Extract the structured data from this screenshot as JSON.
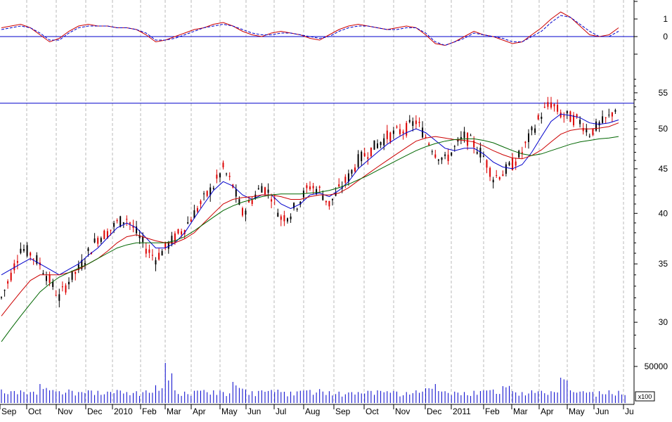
{
  "chart_data": [
    {
      "type": "line",
      "panel": "oscillator",
      "title": "",
      "y_ticks": [
        "1",
        "0"
      ],
      "reference_line": 0,
      "series": [
        {
          "color": "#cc0000",
          "style": "solid",
          "values": [
            0.5,
            0.6,
            0.7,
            0.5,
            0.1,
            -0.3,
            -0.1,
            0.3,
            0.6,
            0.7,
            0.6,
            0.6,
            0.5,
            0.5,
            0.4,
            0.1,
            -0.3,
            -0.2,
            0.0,
            0.2,
            0.4,
            0.5,
            0.7,
            0.8,
            0.6,
            0.3,
            0.1,
            0.0,
            0.2,
            0.3,
            0.2,
            0.1,
            -0.1,
            -0.2,
            0.1,
            0.4,
            0.6,
            0.7,
            0.6,
            0.5,
            0.4,
            0.5,
            0.6,
            0.5,
            0.1,
            -0.4,
            -0.5,
            -0.3,
            0.0,
            0.3,
            0.1,
            0.0,
            -0.2,
            -0.4,
            -0.3,
            0.1,
            0.5,
            1.0,
            1.4,
            1.1,
            0.6,
            0.1,
            0.0,
            0.1,
            0.5
          ]
        },
        {
          "color": "#0000cc",
          "style": "dashed",
          "values": [
            0.4,
            0.5,
            0.6,
            0.5,
            0.2,
            -0.2,
            -0.2,
            0.2,
            0.5,
            0.6,
            0.6,
            0.6,
            0.5,
            0.5,
            0.4,
            0.2,
            -0.2,
            -0.2,
            -0.1,
            0.1,
            0.3,
            0.5,
            0.6,
            0.7,
            0.6,
            0.4,
            0.2,
            0.1,
            0.1,
            0.2,
            0.2,
            0.1,
            0.0,
            -0.1,
            0.0,
            0.3,
            0.5,
            0.6,
            0.6,
            0.5,
            0.4,
            0.4,
            0.5,
            0.5,
            0.2,
            -0.3,
            -0.5,
            -0.3,
            -0.1,
            0.2,
            0.1,
            0.0,
            -0.1,
            -0.3,
            -0.3,
            0.0,
            0.3,
            0.8,
            1.2,
            1.1,
            0.7,
            0.3,
            0.0,
            0.0,
            0.3
          ]
        }
      ]
    },
    {
      "type": "line",
      "panel": "price",
      "title": "",
      "y_axis": {
        "scale": "log",
        "range": [
          27.5,
          57.5
        ],
        "ticks": [
          55,
          50,
          45,
          40,
          35,
          30
        ]
      },
      "reference_line": 53.5,
      "series": [
        {
          "name": "",
          "color": "#000000",
          "style": "price",
          "values": [
            32.0,
            34.0,
            36.5,
            36.0,
            35.0,
            33.5,
            32.0,
            33.5,
            34.5,
            36.0,
            37.5,
            38.0,
            39.0,
            39.5,
            38.0,
            36.5,
            35.5,
            36.5,
            37.5,
            38.5,
            40.0,
            41.5,
            43.0,
            45.0,
            43.0,
            40.0,
            41.5,
            43.0,
            42.0,
            39.5,
            40.0,
            41.5,
            43.0,
            42.5,
            41.0,
            42.5,
            44.0,
            46.0,
            47.0,
            48.0,
            49.0,
            49.5,
            50.0,
            51.0,
            49.0,
            47.0,
            46.0,
            47.5,
            49.0,
            48.0,
            46.5,
            44.0,
            44.5,
            45.5,
            47.0,
            49.5,
            52.0,
            53.5,
            52.0,
            51.5,
            51.0,
            49.5,
            50.5,
            51.5,
            53.5
          ]
        },
        {
          "name": "",
          "color": "#0000cc",
          "style": "solid",
          "values": [
            34.0,
            34.5,
            35.0,
            35.5,
            35.0,
            34.5,
            34.0,
            34.5,
            35.0,
            35.8,
            36.5,
            37.5,
            38.5,
            39.0,
            38.5,
            37.5,
            36.5,
            36.5,
            37.0,
            38.0,
            39.5,
            41.0,
            42.5,
            43.5,
            43.0,
            42.0,
            41.5,
            42.0,
            42.0,
            41.0,
            40.5,
            41.0,
            42.0,
            42.2,
            41.8,
            42.5,
            43.5,
            45.0,
            46.0,
            47.0,
            48.0,
            48.8,
            49.5,
            50.0,
            49.5,
            48.5,
            47.5,
            47.2,
            47.5,
            47.5,
            46.8,
            45.8,
            45.2,
            45.0,
            45.5,
            47.0,
            49.0,
            51.0,
            52.0,
            51.8,
            51.5,
            50.8,
            50.6,
            50.8,
            51.2
          ]
        },
        {
          "name": "",
          "color": "#cc0000",
          "style": "solid",
          "values": [
            30.5,
            31.5,
            32.5,
            33.5,
            34.0,
            34.0,
            34.0,
            34.2,
            34.5,
            35.0,
            35.5,
            36.2,
            37.0,
            37.6,
            37.8,
            37.5,
            37.2,
            37.0,
            37.0,
            37.4,
            38.0,
            39.0,
            40.0,
            41.0,
            41.5,
            41.7,
            41.8,
            42.0,
            42.0,
            41.8,
            41.5,
            41.5,
            41.8,
            42.0,
            42.0,
            42.2,
            42.8,
            43.6,
            44.4,
            45.2,
            46.0,
            46.8,
            47.6,
            48.4,
            48.8,
            49.0,
            48.8,
            48.6,
            48.5,
            48.3,
            47.8,
            47.2,
            46.7,
            46.3,
            46.2,
            46.6,
            47.3,
            48.3,
            49.3,
            49.8,
            50.0,
            50.0,
            50.1,
            50.3,
            50.8
          ]
        },
        {
          "name": "",
          "color": "#006600",
          "style": "solid",
          "values": [
            28.5,
            29.5,
            30.5,
            31.5,
            32.5,
            33.2,
            33.8,
            34.2,
            34.6,
            35.0,
            35.5,
            36.0,
            36.5,
            36.8,
            37.0,
            37.0,
            37.0,
            37.0,
            37.2,
            37.6,
            38.2,
            38.9,
            39.6,
            40.3,
            40.8,
            41.2,
            41.5,
            41.8,
            42.0,
            42.1,
            42.1,
            42.1,
            42.2,
            42.3,
            42.5,
            42.8,
            43.2,
            43.7,
            44.2,
            44.8,
            45.4,
            46.0,
            46.6,
            47.2,
            47.7,
            48.1,
            48.4,
            48.6,
            48.7,
            48.7,
            48.5,
            48.2,
            47.7,
            47.2,
            46.8,
            46.6,
            46.8,
            47.2,
            47.6,
            48.0,
            48.3,
            48.5,
            48.7,
            48.8,
            49.0
          ]
        }
      ]
    },
    {
      "type": "bar",
      "panel": "volume",
      "title": "",
      "y_axis": {
        "label": "50000",
        "multiplier": "x100"
      },
      "color": "#0000cc",
      "values": [
        32000,
        28000,
        30000,
        26000,
        45000,
        30000,
        28000,
        32000,
        26000,
        30000,
        29000,
        27000,
        31000,
        26000,
        28000,
        30000,
        42000,
        95000,
        30000,
        27000,
        29000,
        31000,
        30000,
        26000,
        50000,
        34000,
        28000,
        30000,
        31000,
        26000,
        27000,
        29000,
        31000,
        33000,
        28000,
        27000,
        25000,
        26000,
        29000,
        30000,
        28000,
        27000,
        26000,
        30000,
        35000,
        45000,
        28000,
        27000,
        26000,
        29000,
        30000,
        32000,
        40000,
        28000,
        26000,
        30000,
        29000,
        28000,
        60000,
        30000,
        27000,
        26000,
        28000,
        30000,
        29000
      ]
    }
  ],
  "x_axis": {
    "labels": [
      "Sep",
      "Oct",
      "Nov",
      "Dec",
      "2010",
      "Feb",
      "Mar",
      "Apr",
      "May",
      "Jun",
      "Jul",
      "Aug",
      "Sep",
      "Oct",
      "Nov",
      "Dec",
      "2011",
      "Feb",
      "Mar",
      "Apr",
      "May",
      "Jun",
      "Ju"
    ]
  },
  "grid": {
    "vertical": "dashed",
    "horizontal": "none"
  }
}
